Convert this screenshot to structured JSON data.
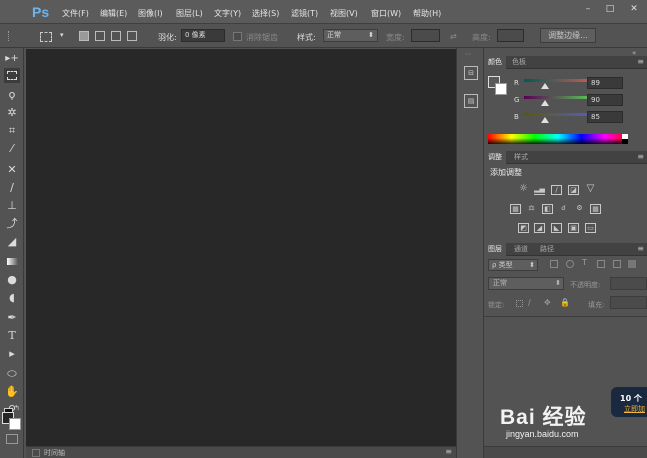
{
  "app": {
    "logo": "Ps"
  },
  "menu": [
    "文件(F)",
    "编辑(E)",
    "图像(I)",
    "图层(L)",
    "文字(Y)",
    "选择(S)",
    "滤镜(T)",
    "视图(V)",
    "窗口(W)",
    "帮助(H)"
  ],
  "window_controls": {
    "minimize": "–",
    "restore": "□",
    "close": "✕"
  },
  "options_bar": {
    "feather_label": "羽化:",
    "feather_value": "0 像素",
    "antialias_label": "消除锯齿",
    "style_label": "样式:",
    "style_value": "正常",
    "width_label": "宽度:",
    "height_label": "高度:",
    "refine_edge_button": "调整边缘..."
  },
  "status_bar": {
    "label": "时间轴"
  },
  "panels": {
    "color": {
      "tabs": [
        "颜色",
        "色板"
      ],
      "r_label": "R",
      "r_value": "89",
      "g_label": "G",
      "g_value": "90",
      "b_label": "B",
      "b_value": "85"
    },
    "adjustments": {
      "tabs": [
        "调整",
        "样式"
      ],
      "title": "添加调整"
    },
    "layers": {
      "tabs": [
        "图层",
        "通道",
        "路径"
      ],
      "filter_kind": "ρ 类型",
      "blend_mode": "正常",
      "opacity_label": "不透明度:",
      "lock_label": "锁定:",
      "fill_label": "填充:"
    }
  },
  "watermark": {
    "brand": "Bai 经验",
    "url": "jingyan.baidu.com",
    "badge_count": "10 个",
    "badge_link": "立即加"
  },
  "colors": {
    "accent_blue": "#6fb3ec",
    "canvas_bg": "#282828",
    "panel_bg": "#535353"
  }
}
